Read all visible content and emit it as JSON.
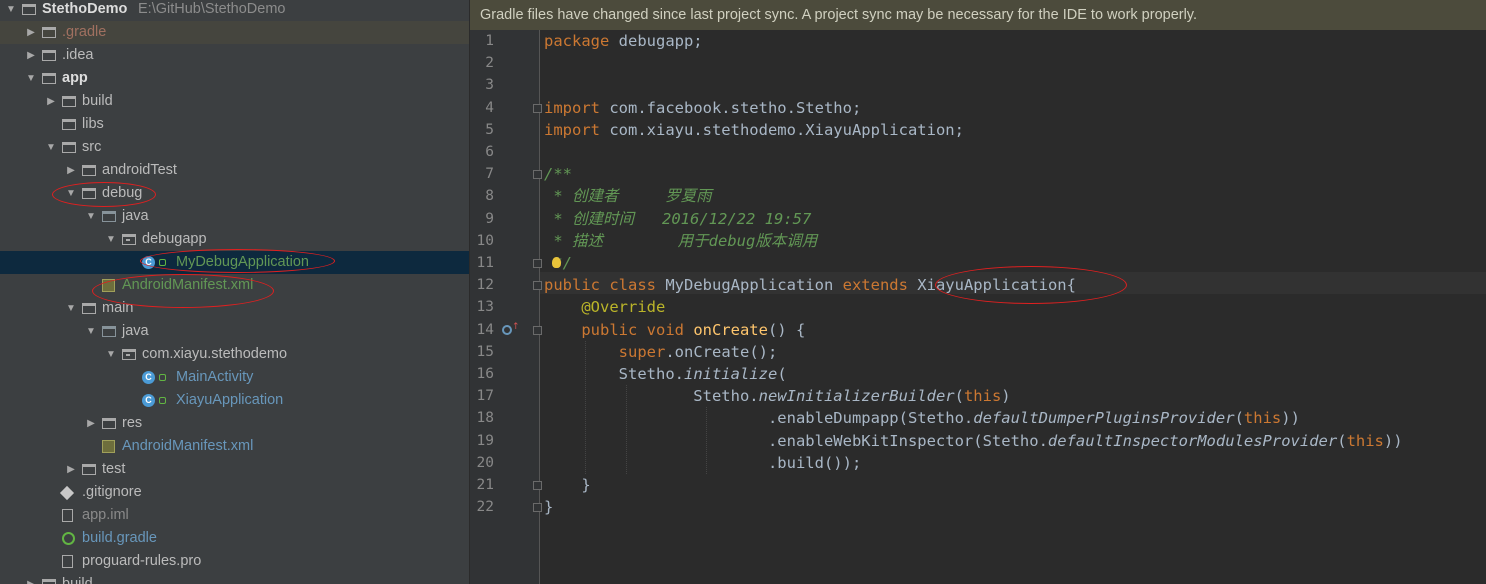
{
  "project_tree": {
    "root": {
      "name": "StethoDemo",
      "path": "E:\\GitHub\\StethoDemo"
    },
    "items": [
      {
        "label": "StethoDemo",
        "level": 0,
        "kind": "folder",
        "expanded": true
      },
      {
        "label": ".gradle",
        "level": 1,
        "kind": "folder",
        "expanded": false
      },
      {
        "label": ".idea",
        "level": 1,
        "kind": "folder",
        "expanded": false
      },
      {
        "label": "app",
        "level": 1,
        "kind": "module",
        "expanded": true
      },
      {
        "label": "build",
        "level": 2,
        "kind": "folder",
        "expanded": false
      },
      {
        "label": "libs",
        "level": 2,
        "kind": "folder"
      },
      {
        "label": "src",
        "level": 2,
        "kind": "folder",
        "expanded": true
      },
      {
        "label": "androidTest",
        "level": 3,
        "kind": "folder",
        "expanded": false
      },
      {
        "label": "debug",
        "level": 3,
        "kind": "folder",
        "expanded": true
      },
      {
        "label": "java",
        "level": 4,
        "kind": "source-folder",
        "expanded": true
      },
      {
        "label": "debugapp",
        "level": 5,
        "kind": "package",
        "expanded": true
      },
      {
        "label": "MyDebugApplication",
        "level": 6,
        "kind": "class",
        "selected": true
      },
      {
        "label": "AndroidManifest.xml",
        "level": 4,
        "kind": "manifest"
      },
      {
        "label": "main",
        "level": 3,
        "kind": "folder",
        "expanded": true
      },
      {
        "label": "java",
        "level": 4,
        "kind": "source-folder",
        "expanded": true
      },
      {
        "label": "com.xiayu.stethodemo",
        "level": 5,
        "kind": "package",
        "expanded": true
      },
      {
        "label": "MainActivity",
        "level": 6,
        "kind": "class"
      },
      {
        "label": "XiayuApplication",
        "level": 6,
        "kind": "class"
      },
      {
        "label": "res",
        "level": 4,
        "kind": "folder",
        "expanded": false
      },
      {
        "label": "AndroidManifest.xml",
        "level": 4,
        "kind": "manifest"
      },
      {
        "label": "test",
        "level": 3,
        "kind": "folder",
        "expanded": false
      },
      {
        "label": ".gitignore",
        "level": 2,
        "kind": "git"
      },
      {
        "label": "app.iml",
        "level": 2,
        "kind": "iml"
      },
      {
        "label": "build.gradle",
        "level": 2,
        "kind": "gradle"
      },
      {
        "label": "proguard-rules.pro",
        "level": 2,
        "kind": "file"
      },
      {
        "label": "build",
        "level": 1,
        "kind": "folder",
        "expanded": false
      }
    ]
  },
  "banner": {
    "text": "Gradle files have changed since last project sync. A project sync may be necessary for the IDE to work properly."
  },
  "editor": {
    "line_numbers": [
      "1",
      "2",
      "3",
      "4",
      "5",
      "6",
      "7",
      "8",
      "9",
      "10",
      "11",
      "12",
      "13",
      "14",
      "15",
      "16",
      "17",
      "18",
      "19",
      "20",
      "21",
      "22"
    ],
    "lines": [
      [
        {
          "t": "package ",
          "c": "kw"
        },
        {
          "t": "debugapp;",
          "c": ""
        }
      ],
      [],
      [],
      [
        {
          "t": "import ",
          "c": "kw"
        },
        {
          "t": "com.facebook.stetho.Stetho;",
          "c": ""
        }
      ],
      [
        {
          "t": "import ",
          "c": "kw"
        },
        {
          "t": "com.xiayu.stethodemo.XiayuApplication;",
          "c": ""
        }
      ],
      [],
      [
        {
          "t": "/**",
          "c": "cm"
        }
      ],
      [
        {
          "t": " * 创建者     罗夏雨",
          "c": "cm"
        }
      ],
      [
        {
          "t": " * 创建时间   2016/12/22 19:57",
          "c": "cm"
        }
      ],
      [
        {
          "t": " * 描述        用于debug版本调用",
          "c": "cm"
        }
      ],
      [
        {
          "t": " */",
          "c": "cm"
        }
      ],
      [
        {
          "t": "public class ",
          "c": "kw"
        },
        {
          "t": "MyDebugApplication ",
          "c": ""
        },
        {
          "t": "extends ",
          "c": "kw"
        },
        {
          "t": "XiayuApplication{",
          "c": ""
        }
      ],
      [
        {
          "t": "    ",
          "c": ""
        },
        {
          "t": "@Override",
          "c": "an"
        }
      ],
      [
        {
          "t": "    ",
          "c": ""
        },
        {
          "t": "public void ",
          "c": "kw"
        },
        {
          "t": "onCreate",
          "c": "fn"
        },
        {
          "t": "() {",
          "c": ""
        }
      ],
      [
        {
          "t": "        ",
          "c": ""
        },
        {
          "t": "super",
          "c": "kw"
        },
        {
          "t": ".onCreate();",
          "c": ""
        }
      ],
      [
        {
          "t": "        Stetho.",
          "c": ""
        },
        {
          "t": "initialize",
          "c": "it"
        },
        {
          "t": "(",
          "c": ""
        }
      ],
      [
        {
          "t": "                Stetho.",
          "c": ""
        },
        {
          "t": "newInitializerBuilder",
          "c": "it"
        },
        {
          "t": "(",
          "c": ""
        },
        {
          "t": "this",
          "c": "kw"
        },
        {
          "t": ")",
          "c": ""
        }
      ],
      [
        {
          "t": "                        .enableDumpapp(Stetho.",
          "c": ""
        },
        {
          "t": "defaultDumperPluginsProvider",
          "c": "it"
        },
        {
          "t": "(",
          "c": ""
        },
        {
          "t": "this",
          "c": "kw"
        },
        {
          "t": "))",
          "c": ""
        }
      ],
      [
        {
          "t": "                        .enableWebKitInspector(Stetho.",
          "c": ""
        },
        {
          "t": "defaultInspectorModulesProvider",
          "c": "it"
        },
        {
          "t": "(",
          "c": ""
        },
        {
          "t": "this",
          "c": "kw"
        },
        {
          "t": "))",
          "c": ""
        }
      ],
      [
        {
          "t": "                        .build());",
          "c": ""
        }
      ],
      [
        {
          "t": "    }",
          "c": ""
        }
      ],
      [
        {
          "t": "}",
          "c": ""
        }
      ]
    ]
  }
}
